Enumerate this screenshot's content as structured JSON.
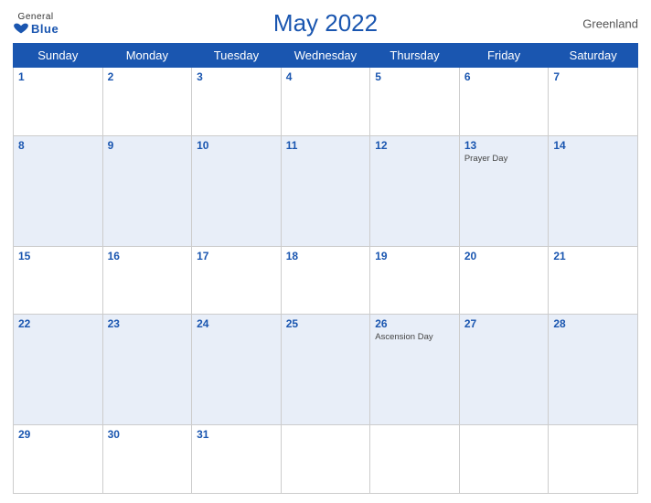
{
  "logo": {
    "general": "General",
    "blue": "Blue"
  },
  "title": "May 2022",
  "region": "Greenland",
  "days_of_week": [
    "Sunday",
    "Monday",
    "Tuesday",
    "Wednesday",
    "Thursday",
    "Friday",
    "Saturday"
  ],
  "weeks": [
    {
      "shaded": false,
      "days": [
        {
          "num": "1",
          "event": ""
        },
        {
          "num": "2",
          "event": ""
        },
        {
          "num": "3",
          "event": ""
        },
        {
          "num": "4",
          "event": ""
        },
        {
          "num": "5",
          "event": ""
        },
        {
          "num": "6",
          "event": ""
        },
        {
          "num": "7",
          "event": ""
        }
      ]
    },
    {
      "shaded": true,
      "days": [
        {
          "num": "8",
          "event": ""
        },
        {
          "num": "9",
          "event": ""
        },
        {
          "num": "10",
          "event": ""
        },
        {
          "num": "11",
          "event": ""
        },
        {
          "num": "12",
          "event": ""
        },
        {
          "num": "13",
          "event": "Prayer Day"
        },
        {
          "num": "14",
          "event": ""
        }
      ]
    },
    {
      "shaded": false,
      "days": [
        {
          "num": "15",
          "event": ""
        },
        {
          "num": "16",
          "event": ""
        },
        {
          "num": "17",
          "event": ""
        },
        {
          "num": "18",
          "event": ""
        },
        {
          "num": "19",
          "event": ""
        },
        {
          "num": "20",
          "event": ""
        },
        {
          "num": "21",
          "event": ""
        }
      ]
    },
    {
      "shaded": true,
      "days": [
        {
          "num": "22",
          "event": ""
        },
        {
          "num": "23",
          "event": ""
        },
        {
          "num": "24",
          "event": ""
        },
        {
          "num": "25",
          "event": ""
        },
        {
          "num": "26",
          "event": "Ascension Day"
        },
        {
          "num": "27",
          "event": ""
        },
        {
          "num": "28",
          "event": ""
        }
      ]
    },
    {
      "shaded": false,
      "days": [
        {
          "num": "29",
          "event": ""
        },
        {
          "num": "30",
          "event": ""
        },
        {
          "num": "31",
          "event": ""
        },
        {
          "num": "",
          "event": ""
        },
        {
          "num": "",
          "event": ""
        },
        {
          "num": "",
          "event": ""
        },
        {
          "num": "",
          "event": ""
        }
      ]
    }
  ]
}
